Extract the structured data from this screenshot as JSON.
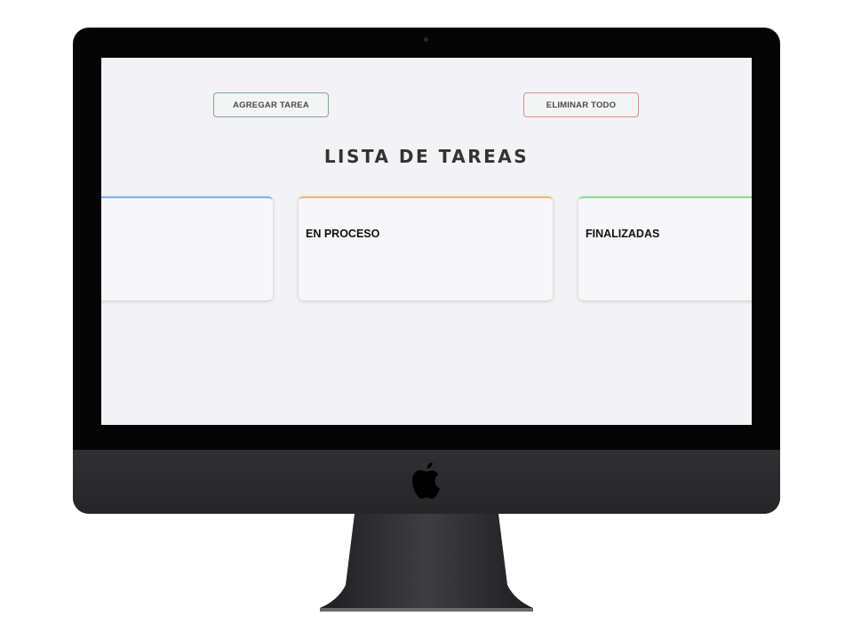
{
  "toolbar": {
    "add_label": "AGREGAR TAREA",
    "clear_label": "ELIMINAR TODO"
  },
  "page": {
    "title": "LISTA DE TAREAS"
  },
  "columns": [
    {
      "label": "",
      "accent": "#7eb0ea"
    },
    {
      "label": "EN PROCESO",
      "accent": "#f0b46e"
    },
    {
      "label": "FINALIZADAS",
      "accent": "#86dc8f"
    }
  ],
  "device": {
    "logo_icon": "apple-logo-icon"
  }
}
